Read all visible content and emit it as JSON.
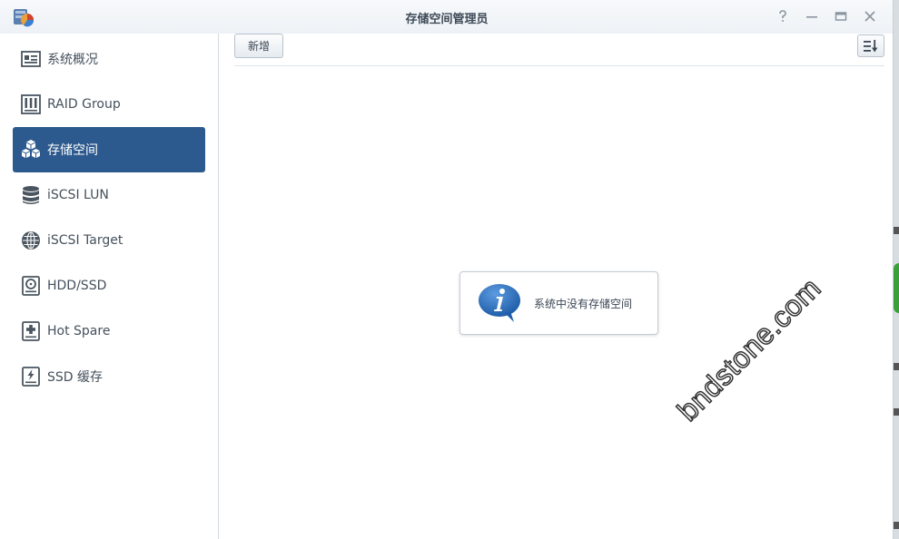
{
  "window": {
    "title": "存储空间管理员",
    "controls": {
      "help": "?",
      "minimize": "—",
      "maximize": "▭",
      "close": "✕"
    }
  },
  "sidebar": {
    "items": [
      {
        "label": "系统概况",
        "icon": "overview-icon",
        "active": false
      },
      {
        "label": "RAID Group",
        "icon": "raid-icon",
        "active": false
      },
      {
        "label": "存储空间",
        "icon": "volume-cubes-icon",
        "active": true
      },
      {
        "label": "iSCSI LUN",
        "icon": "database-icon",
        "active": false
      },
      {
        "label": "iSCSI Target",
        "icon": "globe-icon",
        "active": false
      },
      {
        "label": "HDD/SSD",
        "icon": "disk-icon",
        "active": false
      },
      {
        "label": "Hot Spare",
        "icon": "hot-spare-icon",
        "active": false
      },
      {
        "label": "SSD 缓存",
        "icon": "ssd-cache-icon",
        "active": false
      }
    ]
  },
  "toolbar": {
    "new_label": "新增"
  },
  "empty_state": {
    "message": "系统中没有存储空间"
  },
  "watermark": {
    "text": "bndstone.com"
  },
  "colors": {
    "accent": "#2d5a8e",
    "info_blue": "#2b6db3"
  }
}
